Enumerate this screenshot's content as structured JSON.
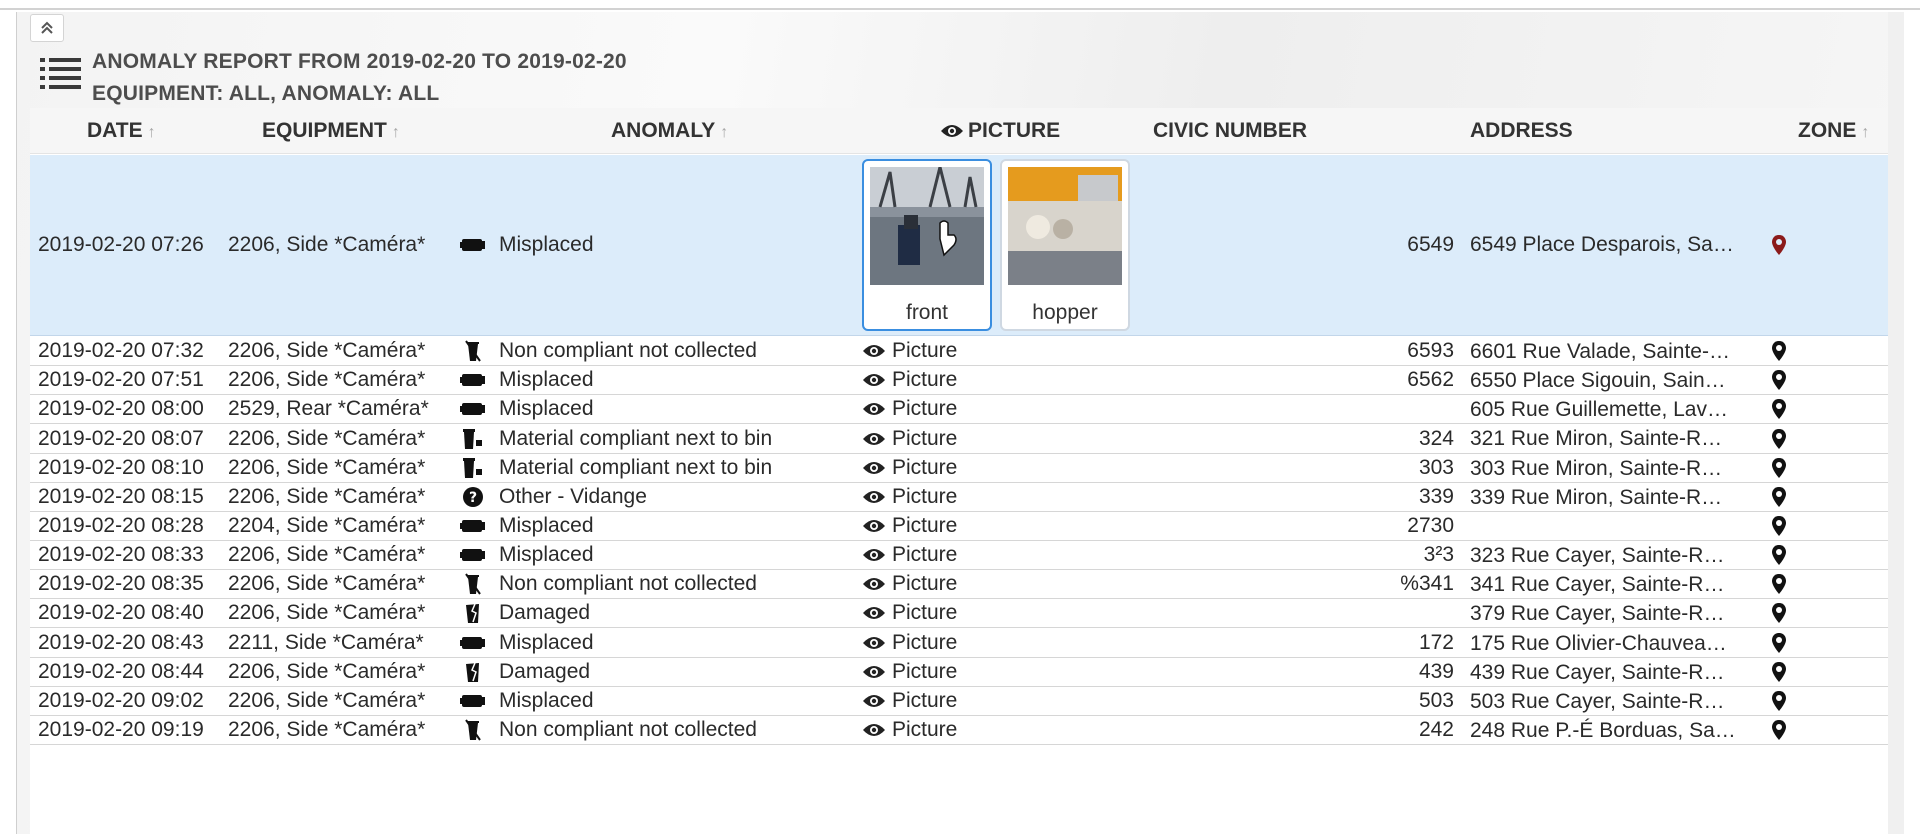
{
  "report": {
    "title_line1": "ANOMALY REPORT FROM 2019-02-20 TO 2019-02-20",
    "title_line2": "EQUIPMENT: ALL, ANOMALY: ALL"
  },
  "columns": {
    "date": "DATE",
    "equipment": "EQUIPMENT",
    "anomaly": "ANOMALY",
    "picture": "PICTURE",
    "civic_number": "CIVIC NUMBER",
    "address": "ADDRESS",
    "zone": "ZONE"
  },
  "sort_arrow": "↑",
  "picture_link_label": "Picture",
  "selected_row": {
    "date": "2019-02-20 07:26",
    "equipment": "2206, Side *Caméra*",
    "anomaly_icon": "misplaced-bin-icon",
    "anomaly": "Misplaced",
    "thumbnails": [
      {
        "label": "front",
        "icon": "front-camera-photo"
      },
      {
        "label": "hopper",
        "icon": "hopper-camera-photo"
      }
    ],
    "civic": "6549",
    "address": "6549 Place Desparois, Sa…",
    "zone_icon": "map-pin-icon"
  },
  "rows": [
    {
      "date": "2019-02-20 07:32",
      "equipment": "2206, Side *Caméra*",
      "anomaly_icon": "non-compliant-icon",
      "anomaly": "Non compliant not collected",
      "civic": "6593",
      "address": "6601 Rue Valade, Sainte-…"
    },
    {
      "date": "2019-02-20 07:51",
      "equipment": "2206, Side *Caméra*",
      "anomaly_icon": "misplaced-bin-icon",
      "anomaly": "Misplaced",
      "civic": "6562",
      "address": "6550 Place Sigouin, Sain…"
    },
    {
      "date": "2019-02-20 08:00",
      "equipment": "2529, Rear *Caméra*",
      "anomaly_icon": "misplaced-bin-icon",
      "anomaly": "Misplaced",
      "civic": "",
      "address": "605 Rue Guillemette, Lav…"
    },
    {
      "date": "2019-02-20 08:07",
      "equipment": "2206, Side *Caméra*",
      "anomaly_icon": "material-next-to-bin-icon",
      "anomaly": "Material compliant next to bin",
      "civic": "324",
      "address": "321 Rue Miron, Sainte-R…"
    },
    {
      "date": "2019-02-20 08:10",
      "equipment": "2206, Side *Caméra*",
      "anomaly_icon": "material-next-to-bin-icon",
      "anomaly": "Material compliant next to bin",
      "civic": "303",
      "address": "303 Rue Miron, Sainte-R…"
    },
    {
      "date": "2019-02-20 08:15",
      "equipment": "2206, Side *Caméra*",
      "anomaly_icon": "question-circle-icon",
      "anomaly": "Other - Vidange",
      "civic": "339",
      "address": "339 Rue Miron, Sainte-R…"
    },
    {
      "date": "2019-02-20 08:28",
      "equipment": "2204, Side *Caméra*",
      "anomaly_icon": "misplaced-bin-icon",
      "anomaly": "Misplaced",
      "civic": "2730",
      "address": ""
    },
    {
      "date": "2019-02-20 08:33",
      "equipment": "2206, Side *Caméra*",
      "anomaly_icon": "misplaced-bin-icon",
      "anomaly": "Misplaced",
      "civic": "3²3",
      "address": "323 Rue Cayer, Sainte-R…"
    },
    {
      "date": "2019-02-20 08:35",
      "equipment": "2206, Side *Caméra*",
      "anomaly_icon": "non-compliant-icon",
      "anomaly": "Non compliant not collected",
      "civic": "%341",
      "address": "341 Rue Cayer, Sainte-R…"
    },
    {
      "date": "2019-02-20 08:40",
      "equipment": "2206, Side *Caméra*",
      "anomaly_icon": "damaged-bin-icon",
      "anomaly": "Damaged",
      "civic": "",
      "address": "379 Rue Cayer, Sainte-R…"
    },
    {
      "date": "2019-02-20 08:43",
      "equipment": "2211, Side *Caméra*",
      "anomaly_icon": "misplaced-bin-icon",
      "anomaly": "Misplaced",
      "civic": "172",
      "address": "175 Rue Olivier-Chauvea…"
    },
    {
      "date": "2019-02-20 08:44",
      "equipment": "2206, Side *Caméra*",
      "anomaly_icon": "damaged-bin-icon",
      "anomaly": "Damaged",
      "civic": "439",
      "address": "439 Rue Cayer, Sainte-R…"
    },
    {
      "date": "2019-02-20 09:02",
      "equipment": "2206, Side *Caméra*",
      "anomaly_icon": "misplaced-bin-icon",
      "anomaly": "Misplaced",
      "civic": "503",
      "address": "503 Rue Cayer, Sainte-R…"
    },
    {
      "date": "2019-02-20 09:19",
      "equipment": "2206, Side *Caméra*",
      "anomaly_icon": "non-compliant-icon",
      "anomaly": "Non compliant not collected",
      "civic": "242",
      "address": "248 Rue P.-É Borduas, Sa…"
    }
  ],
  "colors": {
    "selected_row_bg": "#dcecfa",
    "active_thumb_border": "#3a8ee0",
    "selected_pin": "#8b1a1a"
  }
}
